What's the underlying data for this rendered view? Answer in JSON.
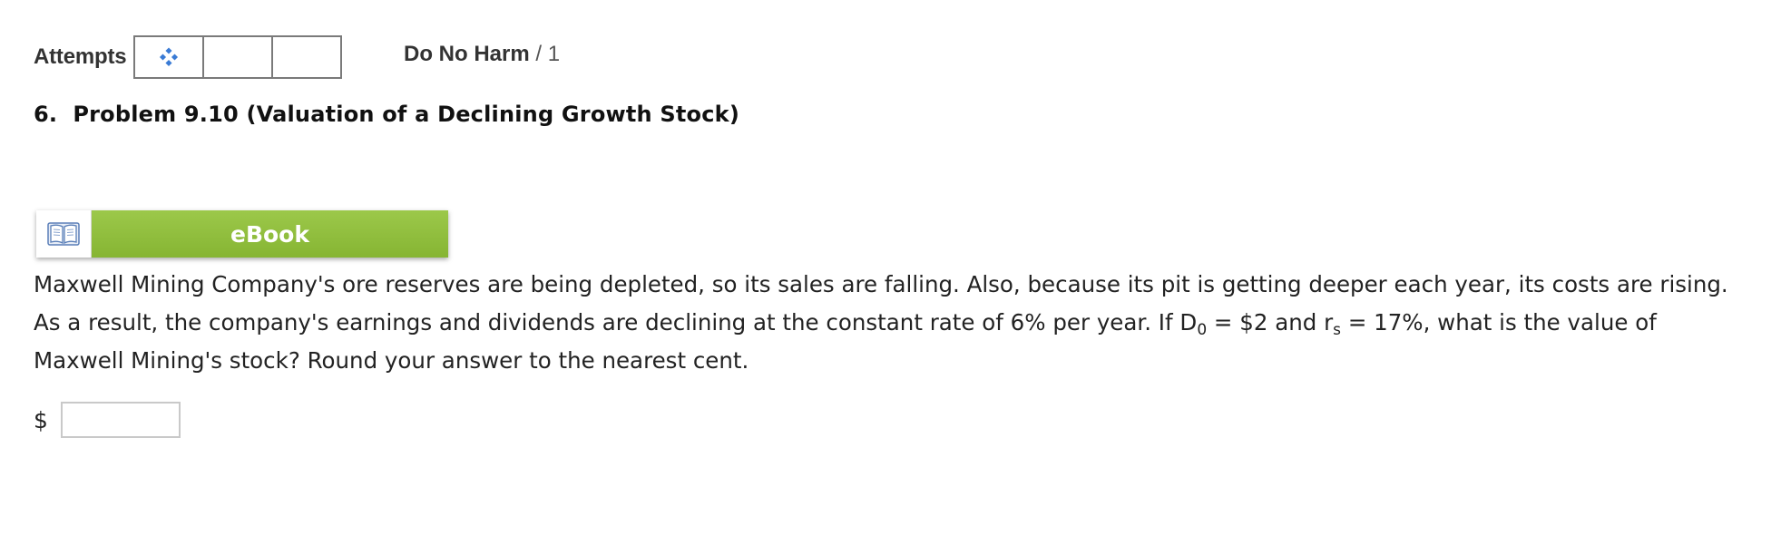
{
  "attempts": {
    "label": "Attempts",
    "boxes": [
      {
        "state": "current",
        "icon": "diamond-dots-icon"
      },
      {
        "state": "empty"
      },
      {
        "state": "empty"
      }
    ]
  },
  "harm": {
    "name": "Do No Harm",
    "score": " / 1"
  },
  "problem": {
    "number": "6.",
    "title": "Problem 9.10 (Valuation of a Declining Growth Stock)"
  },
  "ebook": {
    "label": "eBook",
    "icon": "open-book-icon"
  },
  "question": {
    "text_1": "Maxwell Mining Company's ore reserves are being depleted, so its sales are falling. Also, because its pit is getting deeper each year, its costs are rising. As a result, the company's earnings and dividends are declining at the constant rate of 6% per year. If D",
    "sub_1": "0",
    "text_2": " = $2 and r",
    "sub_2": "s",
    "text_3": " = 17%, what is the value of Maxwell Mining's stock? Round your answer to the nearest cent."
  },
  "answer": {
    "currency": "$",
    "value": ""
  },
  "colors": {
    "ebook_green": "#8fbe3c",
    "icon_blue": "#3a7bd5",
    "border_gray": "#7a7a7a"
  }
}
